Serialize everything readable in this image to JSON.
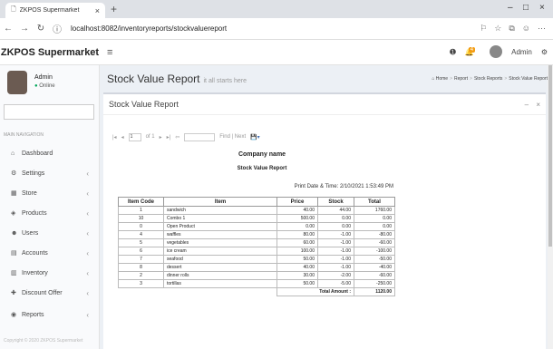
{
  "browser": {
    "tab_title": "ZKPOS Supermarket",
    "tab_close": "×",
    "new_tab": "+",
    "url_host": "localhost",
    "url_path": ":8082/inventoryreports/stockvaluereport",
    "minimize": "–",
    "maximize": "□",
    "close": "×"
  },
  "header": {
    "logo": "ZKPOS Supermarket",
    "notif_count": "4",
    "user": "Admin"
  },
  "user_panel": {
    "name": "Admin",
    "status": "Online"
  },
  "sidebar": {
    "header": "MAIN NAVIGATION",
    "items": [
      {
        "label": "Dashboard",
        "icon": "⌂"
      },
      {
        "label": "Settings",
        "icon": "⚙"
      },
      {
        "label": "Store",
        "icon": "▦"
      },
      {
        "label": "Products",
        "icon": "◈"
      },
      {
        "label": "Users",
        "icon": "☻"
      },
      {
        "label": "Accounts",
        "icon": "▤"
      },
      {
        "label": "Inventory",
        "icon": "▥"
      },
      {
        "label": "Discount Offer",
        "icon": "✚"
      },
      {
        "label": "Reports",
        "icon": "◉"
      }
    ],
    "footer": "Copyright © 2020 ZKPOS Supermarket"
  },
  "content": {
    "title": "Stock Value Report",
    "subtitle": "it all starts here",
    "breadcrumb": [
      "Home",
      "Report",
      "Stock Reports",
      "Stock Value Report"
    ]
  },
  "box": {
    "title": "Stock Value Report",
    "minimize": "–",
    "close": "×"
  },
  "viewer": {
    "page_current": "1",
    "page_of": "of 1",
    "find_label": "Find | Next"
  },
  "report": {
    "company": "Company name",
    "title": "Stock Value Report",
    "print_date": "Print Date & Time: 2/10/2021 1:53:49 PM",
    "columns": [
      "Item Code",
      "Item",
      "Price",
      "Stock",
      "Total"
    ],
    "rows": [
      [
        "1",
        "sandwich",
        "40.00",
        "44.00",
        "1760.00"
      ],
      [
        "10",
        "Combo 1",
        "500.00",
        "0.00",
        "0.00"
      ],
      [
        "0",
        "Open Product",
        "0.00",
        "0.00",
        "0.00"
      ],
      [
        "4",
        "waffles",
        "80.00",
        "-1.00",
        "-80.00"
      ],
      [
        "5",
        "vegetables",
        "60.00",
        "-1.00",
        "-60.00"
      ],
      [
        "6",
        "ice cream",
        "100.00",
        "-1.00",
        "-100.00"
      ],
      [
        "7",
        "seafood",
        "50.00",
        "-1.00",
        "-50.00"
      ],
      [
        "8",
        "dessert",
        "40.00",
        "-1.00",
        "-40.00"
      ],
      [
        "2",
        "dinner rolls",
        "30.00",
        "-2.00",
        "-60.00"
      ],
      [
        "3",
        "tortillas",
        "50.00",
        "-5.00",
        "-250.00"
      ]
    ],
    "total_label": "Total Amount :",
    "total_value": "1120.00"
  }
}
